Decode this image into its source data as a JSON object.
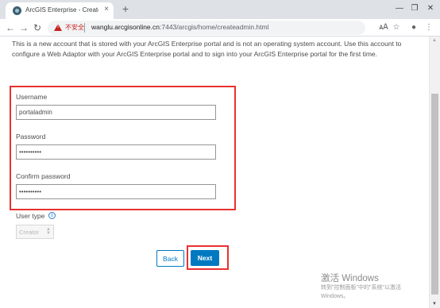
{
  "browser": {
    "tab_title": "ArcGIS Enterprise - Create Initial Administrator Account",
    "tab_close": "×",
    "new_tab": "+",
    "window_controls": {
      "minimize": "—",
      "restore": "❐",
      "close": "✕"
    },
    "nav": {
      "back": "←",
      "forward": "→",
      "reload": "↻"
    },
    "security_label": "不安全",
    "url_host": "wanglu.arcgisonline.cn",
    "url_rest": ":7443/arcgis/home/createadmin.html",
    "toolbar_icons": {
      "translate": "🗚",
      "bookmark": "☆",
      "account": "●",
      "menu": "⋮"
    }
  },
  "page": {
    "intro": "This is a new account that is stored with your ArcGIS Enterprise portal and is not an operating system account. Use this account to configure a Web Adaptor with your ArcGIS Enterprise portal and to sign into your ArcGIS Enterprise portal for the first time.",
    "username": {
      "label": "Username",
      "value": "portaladmin"
    },
    "password": {
      "label": "Password",
      "value": "••••••••••"
    },
    "confirm_password": {
      "label": "Confirm password",
      "value": "••••••••••"
    },
    "user_type": {
      "label": "User type",
      "info_glyph": "i",
      "selected": "Creator"
    },
    "back_label": "Back",
    "next_label": "Next",
    "accent_color": "#0079c1",
    "highlight_color": "#e8322f"
  },
  "watermark": {
    "title": "激活 Windows",
    "line1": "转到\"控制面板\"中的\"系统\"以激活",
    "line2": "Windows。"
  }
}
